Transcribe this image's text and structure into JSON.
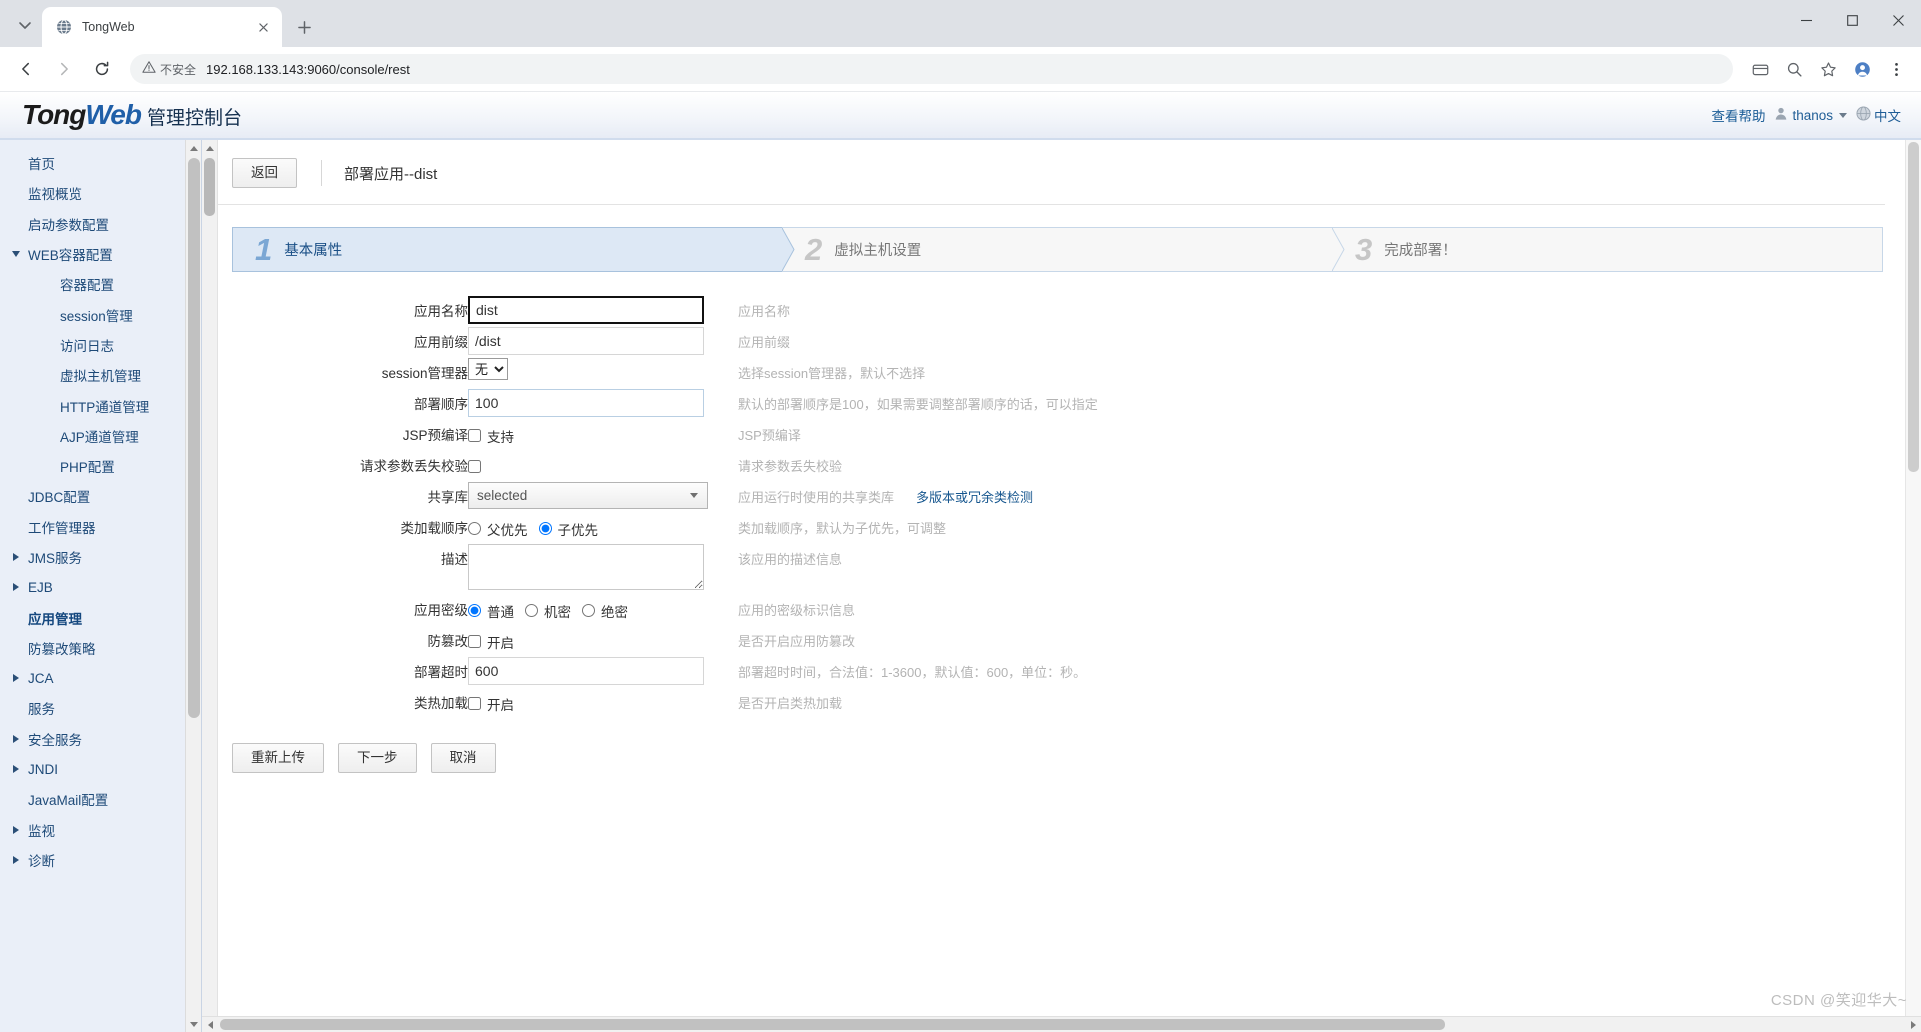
{
  "browser": {
    "tab": {
      "title": "TongWeb",
      "favicon": "globe-icon",
      "close": "close-icon"
    },
    "new_tab": "+",
    "nav": {
      "back": "back-arrow-icon",
      "forward": "forward-arrow-icon",
      "reload": "reload-icon"
    },
    "security": {
      "label": "不安全",
      "icon": "warning-triangle-icon"
    },
    "url": "192.168.133.143:9060/console/rest",
    "toolbar_icons": [
      "payment-card-icon",
      "zoom-icon",
      "bookmark-star-icon",
      "profile-icon",
      "menu-kebab-icon"
    ],
    "window_controls": [
      "minimize-icon",
      "maximize-icon",
      "close-window-icon"
    ]
  },
  "header": {
    "logo_tong": "Tong",
    "logo_web": "Web",
    "logo_sub": "管理控制台",
    "help_link": "查看帮助",
    "user_name": "thanos",
    "user_icon": "user-avatar-icon",
    "lang_icon": "globe-icon",
    "lang_label": "中文"
  },
  "sidebar": {
    "items": [
      {
        "label": "首页",
        "level": 0,
        "arrow": "none",
        "active": false
      },
      {
        "label": "监视概览",
        "level": 0,
        "arrow": "none",
        "active": false
      },
      {
        "label": "启动参数配置",
        "level": 0,
        "arrow": "none",
        "active": false
      },
      {
        "label": "WEB容器配置",
        "level": 0,
        "arrow": "down",
        "active": false
      },
      {
        "label": "容器配置",
        "level": 1,
        "arrow": "none",
        "active": false
      },
      {
        "label": "session管理",
        "level": 1,
        "arrow": "none",
        "active": false
      },
      {
        "label": "访问日志",
        "level": 1,
        "arrow": "none",
        "active": false
      },
      {
        "label": "虚拟主机管理",
        "level": 1,
        "arrow": "none",
        "active": false
      },
      {
        "label": "HTTP通道管理",
        "level": 1,
        "arrow": "none",
        "active": false
      },
      {
        "label": "AJP通道管理",
        "level": 1,
        "arrow": "none",
        "active": false
      },
      {
        "label": "PHP配置",
        "level": 1,
        "arrow": "none",
        "active": false
      },
      {
        "label": "JDBC配置",
        "level": 0,
        "arrow": "none",
        "active": false
      },
      {
        "label": "工作管理器",
        "level": 0,
        "arrow": "none",
        "active": false
      },
      {
        "label": "JMS服务",
        "level": 0,
        "arrow": "right",
        "active": false
      },
      {
        "label": "EJB",
        "level": 0,
        "arrow": "right",
        "active": false
      },
      {
        "label": "应用管理",
        "level": 0,
        "arrow": "none",
        "active": true
      },
      {
        "label": "防篡改策略",
        "level": 0,
        "arrow": "none",
        "active": false
      },
      {
        "label": "JCA",
        "level": 0,
        "arrow": "right",
        "active": false
      },
      {
        "label": "服务",
        "level": 0,
        "arrow": "none",
        "active": false
      },
      {
        "label": "安全服务",
        "level": 0,
        "arrow": "right",
        "active": false
      },
      {
        "label": "JNDI",
        "level": 0,
        "arrow": "right",
        "active": false
      },
      {
        "label": "JavaMail配置",
        "level": 0,
        "arrow": "none",
        "active": false
      },
      {
        "label": "监视",
        "level": 0,
        "arrow": "right",
        "active": false
      },
      {
        "label": "诊断",
        "level": 0,
        "arrow": "right",
        "active": false
      }
    ]
  },
  "page": {
    "back_button": "返回",
    "title": "部署应用--dist",
    "steps": [
      {
        "num": "1",
        "label": "基本属性",
        "active": true
      },
      {
        "num": "2",
        "label": "虚拟主机设置",
        "active": false
      },
      {
        "num": "3",
        "label": "完成部署！",
        "active": false
      }
    ],
    "form": {
      "app_name": {
        "label": "应用名称",
        "value": "dist",
        "hint": "应用名称"
      },
      "app_prefix": {
        "label": "应用前缀",
        "value": "/dist",
        "hint": "应用前缀"
      },
      "session_manager": {
        "label": "session管理器",
        "value": "无",
        "options": [
          "无"
        ],
        "hint": "选择session管理器，默认不选择"
      },
      "deploy_order": {
        "label": "部署顺序",
        "value": "100",
        "hint": "默认的部署顺序是100，如果需要调整部署顺序的话，可以指定"
      },
      "jsp_precompile": {
        "label": "JSP预编译",
        "checkbox_label": "支持",
        "checked": false,
        "hint": "JSP预编译"
      },
      "param_loss_check": {
        "label": "请求参数丢失校验",
        "checkbox_label": "",
        "checked": false,
        "hint": "请求参数丢失校验"
      },
      "shared_lib": {
        "label": "共享库",
        "value": "selected",
        "hint": "应用运行时使用的共享类库",
        "link": "多版本或冗余类检测"
      },
      "class_load_order": {
        "label": "类加载顺序",
        "options": [
          {
            "label": "父优先",
            "selected": false
          },
          {
            "label": "子优先",
            "selected": true
          }
        ],
        "hint": "类加载顺序，默认为子优先，可调整"
      },
      "description": {
        "label": "描述",
        "value": "",
        "hint": "该应用的描述信息"
      },
      "secrecy_level": {
        "label": "应用密级",
        "options": [
          {
            "label": "普通",
            "selected": true
          },
          {
            "label": "机密",
            "selected": false
          },
          {
            "label": "绝密",
            "selected": false
          }
        ],
        "hint": "应用的密级标识信息"
      },
      "anti_tamper": {
        "label": "防篡改",
        "checkbox_label": "开启",
        "checked": false,
        "hint": "是否开启应用防篡改"
      },
      "deploy_timeout": {
        "label": "部署超时",
        "value": "600",
        "hint": "部署超时时间，合法值：1-3600，默认值：600，单位：秒。"
      },
      "hot_reload": {
        "label": "类热加载",
        "checkbox_label": "开启",
        "checked": false,
        "hint": "是否开启类热加载"
      }
    },
    "actions": {
      "reupload": "重新上传",
      "next": "下一步",
      "cancel": "取消"
    }
  },
  "watermark": "CSDN @笑迎华大~"
}
